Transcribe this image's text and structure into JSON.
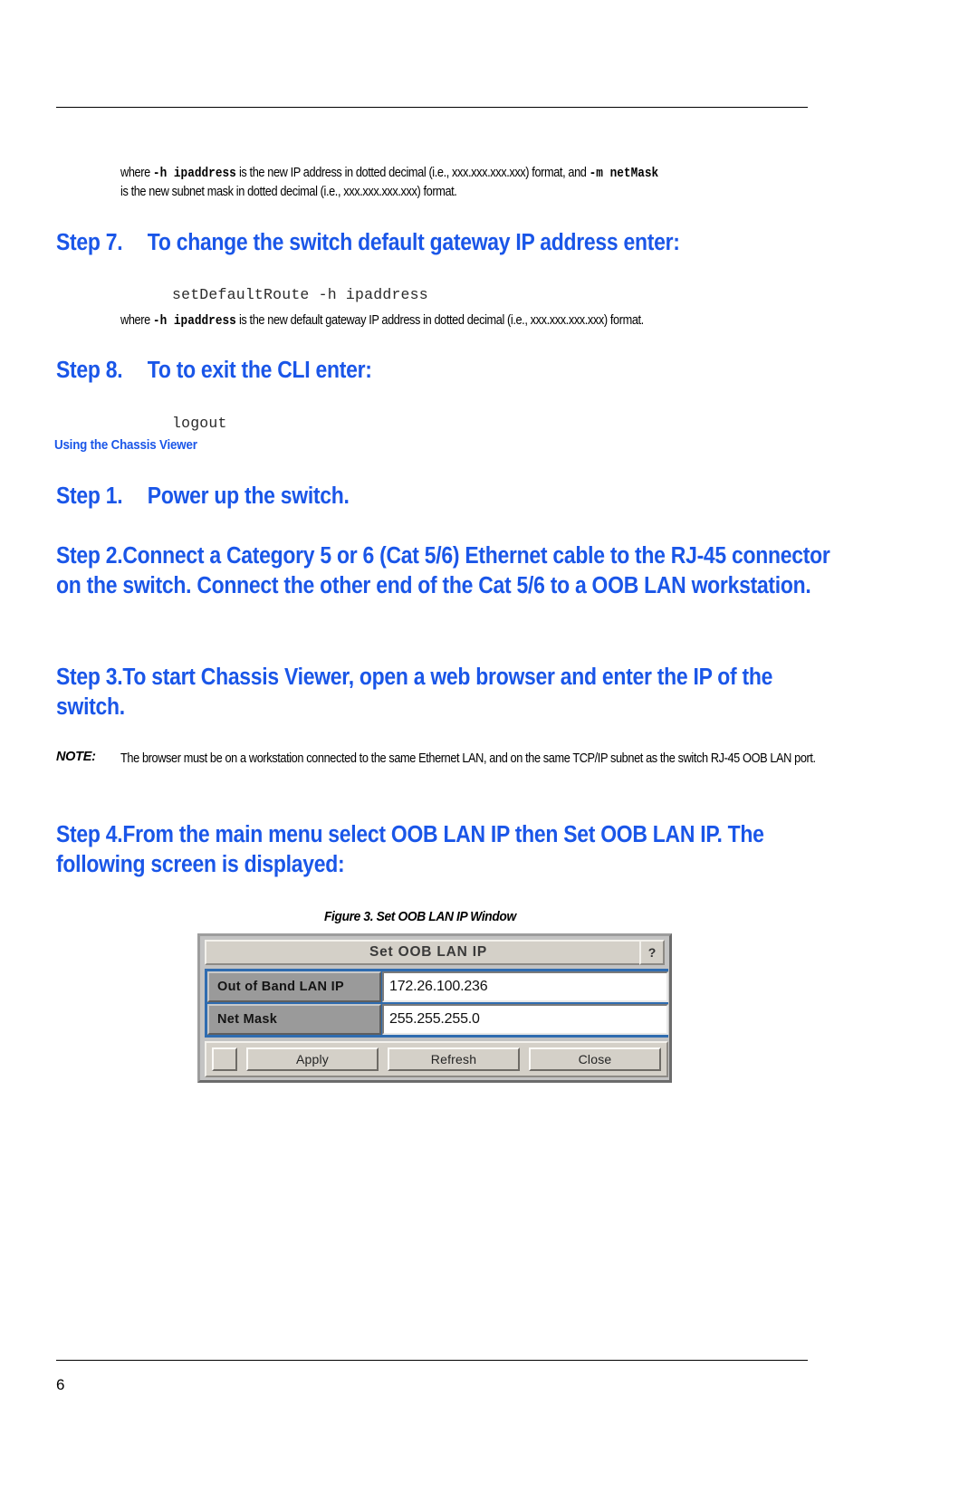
{
  "page": {
    "number": "6",
    "top_rule": true,
    "bottom_rule": true
  },
  "intro_paragraph": {
    "line1_pre": "where ",
    "line1_mono1": "-h ipaddress",
    "line1_mid": " is the new IP address in dotted decimal (i.e., xxx.xxx.xxx.xxx) format, and ",
    "line1_mono2": "-m netMask",
    "line2": "is the new subnet mask in dotted decimal (i.e., xxx.xxx.xxx.xxx) format."
  },
  "step7": {
    "number": "Step 7.",
    "title": "To change the switch default gateway IP address enter:",
    "code": "setDefaultRoute -h ipaddress",
    "note_pre": "where ",
    "note_mono": "-h ipaddress",
    "note_post": " is the new default gateway IP address in dotted decimal (i.e., xxx.xxx.xxx.xxx) format."
  },
  "step8": {
    "number": "Step 8.",
    "title": "To to exit the CLI enter:",
    "code": "logout"
  },
  "section_heading": "Using the Chassis Viewer",
  "step1": {
    "number": "Step 1.",
    "title": "Power up the switch."
  },
  "step2": {
    "number": "Step 2.",
    "title": "Connect a Category 5 or 6 (Cat 5/6) Ethernet cable to the RJ-45 connector on the switch. Connect the other end of the Cat 5/6 to a OOB LAN workstation."
  },
  "step3": {
    "number": "Step 3.",
    "title": "To start Chassis Viewer, open a web browser and enter the IP of the switch."
  },
  "note": {
    "label": "NOTE:",
    "text": "The browser must be on a workstation connected to the same Ethernet LAN, and on the same TCP/IP subnet as the switch RJ-45 OOB LAN port."
  },
  "step4": {
    "number": "Step 4.",
    "title": "From the main menu select OOB LAN IP then Set OOB LAN IP. The following screen is displayed:"
  },
  "figure": {
    "caption": "Figure 3. Set OOB LAN IP Window",
    "dialog": {
      "title": "Set OOB LAN IP",
      "help_button": "?",
      "fields": [
        {
          "label": "Out of Band LAN IP",
          "value": "172.26.100.236"
        },
        {
          "label": "Net Mask",
          "value": "255.255.255.0"
        }
      ],
      "buttons": [
        {
          "label": "Apply"
        },
        {
          "label": "Refresh"
        },
        {
          "label": "Close"
        }
      ],
      "colors": {
        "titlebar": "#d4d0c8",
        "body_accent": "#2f6cb0",
        "label_bg": "#9a9a9a",
        "input_bg": "#ffffff"
      }
    }
  },
  "theme": {
    "heading_color": "#1a56e8"
  }
}
